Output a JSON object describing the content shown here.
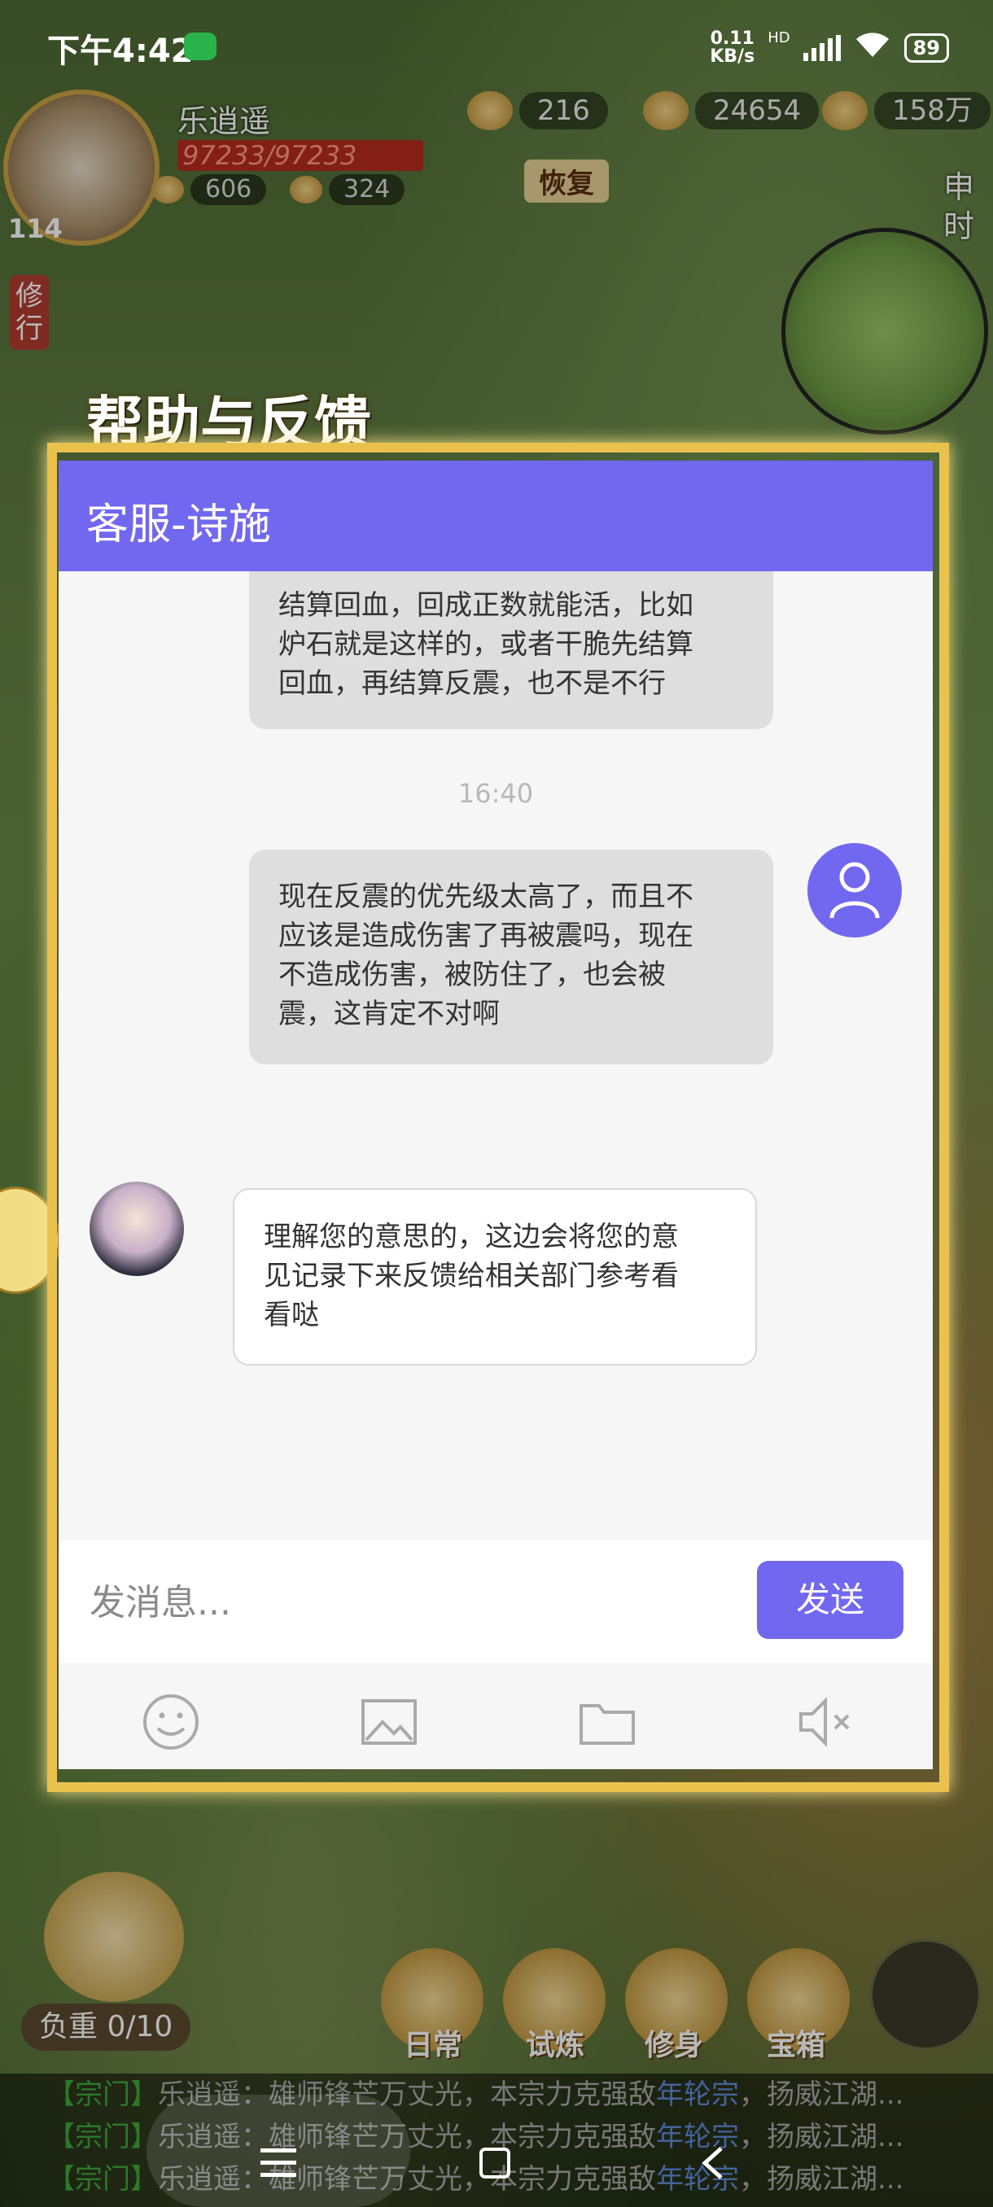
{
  "status_bar": {
    "time": "下午4:42",
    "net_speed_value": "0.11",
    "net_speed_unit": "KB/s",
    "network": "HD",
    "battery": "89"
  },
  "game_hud": {
    "level": "114",
    "player_name": "乐逍遥",
    "hp": "97233/97233",
    "res_1": "606",
    "res_2": "324",
    "currency_1": "216",
    "currency_2": "24654",
    "currency_3": "158万",
    "recover_label": "恢复",
    "side_time": "申时",
    "cultivate_label": "修行",
    "help_title": "帮助与反馈",
    "weight": "负重 0/10",
    "bottom_items": [
      "日常",
      "试炼",
      "修身",
      "宝箱"
    ]
  },
  "chat_dialog": {
    "title": "客服-诗施",
    "messages": [
      {
        "sender": "user",
        "lines": [
          "结算回血，回成正数就能活，比如",
          "炉石就是这样的，或者干脆先结算",
          "回血，再结算反震，也不是不行"
        ]
      },
      {
        "timestamp": "16:40"
      },
      {
        "sender": "user",
        "lines": [
          "现在反震的优先级太高了，而且不",
          "应该是造成伤害了再被震吗，现在",
          "不造成伤害，被防住了，也会被",
          "震，这肯定不对啊"
        ]
      },
      {
        "sender": "agent",
        "lines": [
          "理解您的意思的，这边会将您的意",
          "见记录下来反馈给相关部门参考看",
          "看哒"
        ]
      }
    ],
    "input_placeholder": "发消息...",
    "send_label": "发送",
    "toolbar_icons": [
      "emoji-icon",
      "image-icon",
      "folder-icon",
      "mute-icon"
    ]
  },
  "world_chat": [
    {
      "tag": "【宗门】",
      "text": "乐逍遥：雄师锋芒万丈光，本宗力克强敌",
      "highlight": "年轮宗",
      "tail": "，扬威江湖..."
    },
    {
      "tag": "【宗门】",
      "text": "乐逍遥：雄师锋芒万丈光，本宗力克强敌",
      "highlight": "年轮宗",
      "tail": "，扬威江湖..."
    },
    {
      "tag": "【宗门】",
      "text": "乐逍遥：雄师锋芒万丈光，本宗力克强敌",
      "highlight": "年轮宗",
      "tail": "，扬威江湖..."
    }
  ]
}
